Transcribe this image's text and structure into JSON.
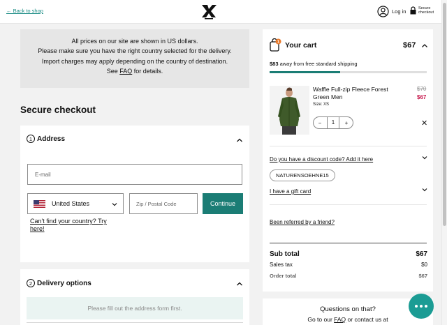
{
  "header": {
    "back_link": "← Back to shop",
    "login_label": "Log in",
    "secure_label": "Secure checkout",
    "logo_icon": "xbionic-logo-icon",
    "user_icon": "user-icon",
    "lock_icon": "lock-icon"
  },
  "info": {
    "line1": "All prices on our site are shown in US dollars.",
    "line2": "Please make sure you have the right country selected for the delivery.",
    "line3": "Import charges may apply depending on the country of destination.",
    "line4_pre": "See ",
    "line4_link": "FAQ",
    "line4_post": " for details."
  },
  "checkout": {
    "title": "Secure checkout",
    "address": {
      "step": "1",
      "title": "Address",
      "email_placeholder": "E-mail",
      "country_value": "United States",
      "zip_placeholder": "Zip / Postal Code",
      "continue_label": "Continue",
      "cant_find": "Can't find your country? Try here!"
    },
    "delivery": {
      "step": "2",
      "title": "Delivery options",
      "note": "Please fill out the address form first."
    }
  },
  "cart": {
    "title": "Your cart",
    "badge_count": "1",
    "total": "$67",
    "shipping_amount": "$83",
    "shipping_text": " away from free standard shipping",
    "shipping_progress_pct": 45,
    "item": {
      "name": "Waffle Full-zip Fleece Forest Green Men",
      "size": "Size: XS",
      "old_price": "$70",
      "new_price": "$67",
      "quantity": "1",
      "minus": "−",
      "plus": "+",
      "remove": "✕"
    },
    "discount_link": "Do you have a discount code? Add it here",
    "discount_code": "NATURENSOEHNE15",
    "gift_card_link": "I have a gift card",
    "referred_link": "Been referred by a friend?",
    "subtotal_label": "Sub total",
    "subtotal_value": "$67",
    "tax_label": "Sales tax",
    "tax_value": "$0",
    "order_total_label": "Order total",
    "order_total_value": "$67"
  },
  "questions": {
    "title": "Questions on that?",
    "text_pre": "Go to our ",
    "text_link": "FAQ",
    "text_post": " or contact us at"
  },
  "colors": {
    "accent": "#1b7d75",
    "sale": "#c7174b",
    "chat": "#1b9c94"
  }
}
